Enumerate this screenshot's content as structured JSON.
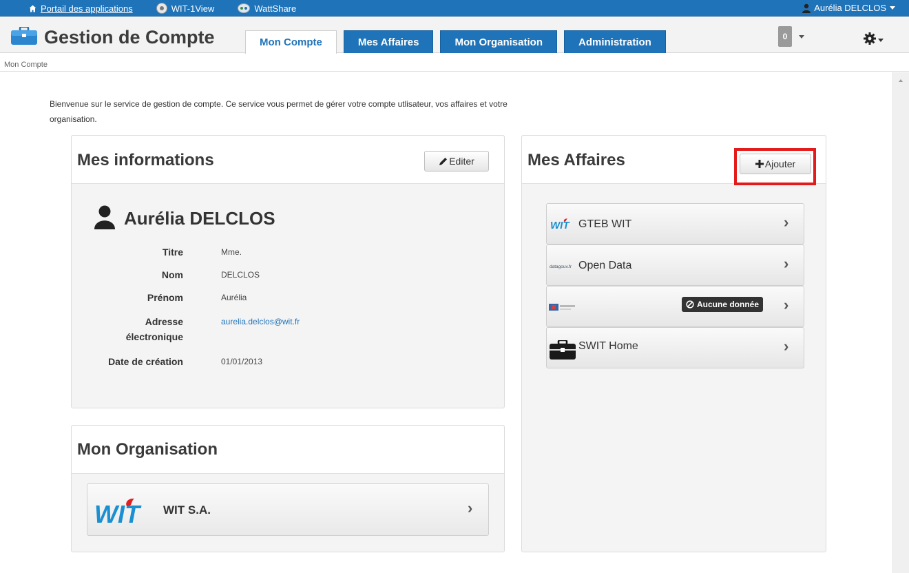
{
  "topbar": {
    "portal_label": "Portail des applications",
    "wit1view_label": "WIT-1View",
    "wattshare_label": "WattShare",
    "user_label": "Aurélia DELCLOS"
  },
  "header": {
    "app_title": "Gestion de Compte",
    "tabs": [
      {
        "label": "Mon Compte",
        "active": true
      },
      {
        "label": "Mes Affaires",
        "active": false
      },
      {
        "label": "Mon Organisation",
        "active": false
      },
      {
        "label": "Administration",
        "active": false
      }
    ],
    "notification_count": "0"
  },
  "breadcrumb": "Mon Compte",
  "intro_text": "Bienvenue sur le service de gestion de compte. Ce service vous permet de gérer votre compte utlisateur, vos affaires et votre organisation.",
  "mes_informations": {
    "title": "Mes informations",
    "edit_label": "Editer",
    "person_name": "Aurélia DELCLOS",
    "fields": [
      {
        "label": "Titre",
        "value": "Mme."
      },
      {
        "label": "Nom",
        "value": "DELCLOS"
      },
      {
        "label": "Prénom",
        "value": "Aurélia"
      },
      {
        "label_line1": "Adresse",
        "label_line2": "électronique",
        "value": "aurelia.delclos@wit.fr"
      },
      {
        "label": "Date de création",
        "value": "01/01/2013"
      }
    ]
  },
  "mon_organisation": {
    "title": "Mon Organisation",
    "org_name": "WIT S.A.",
    "logo_text": "WIT"
  },
  "mes_affaires": {
    "title": "Mes Affaires",
    "add_label": "Ajouter",
    "items": [
      {
        "label": "GTEB WIT",
        "logo_text": "WIT"
      },
      {
        "label": "Open Data",
        "logo_text": "datagouv.fr"
      },
      {
        "label": "",
        "badge": "Aucune donnée"
      },
      {
        "label": "SWIT Home"
      }
    ]
  },
  "colors": {
    "brand_blue": "#1f73b8",
    "highlight_red": "#e41b1b",
    "wit_blue": "#1a8fd1",
    "wit_red": "#e02020"
  }
}
